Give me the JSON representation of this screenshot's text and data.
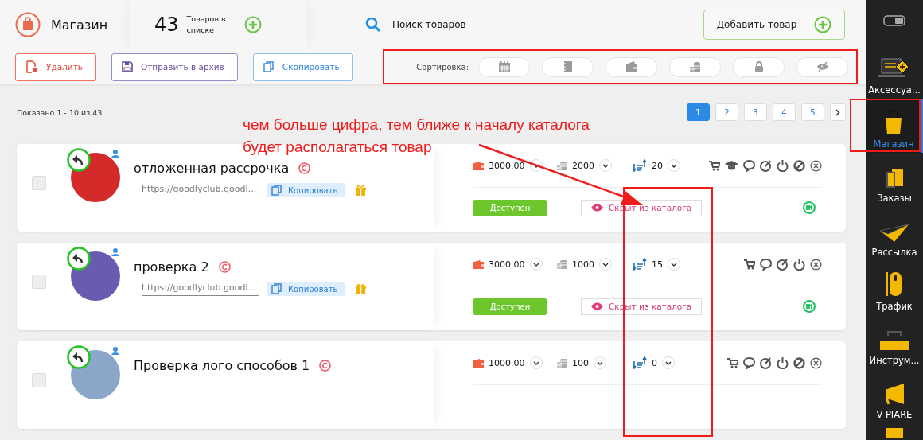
{
  "header": {
    "title": "Магазин",
    "count": "43",
    "count_label": "Товаров в списке",
    "search_label": "Поиск товаров",
    "add_button": "Добавить товар"
  },
  "actions": [
    {
      "kind": "delete",
      "label": "Удалить"
    },
    {
      "kind": "archive",
      "label": "Отправить в архив"
    },
    {
      "kind": "copy",
      "label": "Скопировать"
    }
  ],
  "sort": {
    "label": "Сортировка:"
  },
  "summary": "Показано 1 - 10 из 43",
  "pagination": [
    {
      "label": "1",
      "selected": true
    },
    {
      "label": "2",
      "selected": false
    },
    {
      "label": "3",
      "selected": false
    },
    {
      "label": "4",
      "selected": false
    },
    {
      "label": "5",
      "selected": false
    }
  ],
  "annotation": "чем больше цифра, тем ближе к началу каталога будет располагаться товар",
  "products": [
    {
      "checked": false,
      "title": "отложенная рассрочка",
      "url": "https://goodlyclub.goodl…",
      "copy_label": "Копировать",
      "price": "3000.00",
      "stock": "2000",
      "sort_value": "20",
      "status": "Доступен",
      "visibility": "Скрыт из каталога",
      "actions": [
        {
          "kind": "cart"
        },
        {
          "kind": "cap"
        },
        {
          "kind": "chat"
        },
        {
          "kind": "dial"
        },
        {
          "kind": "power"
        },
        {
          "kind": "ban"
        },
        {
          "kind": "close"
        }
      ]
    },
    {
      "checked": false,
      "title": "проверка 2",
      "url": "https://goodlyclub.goodl…",
      "copy_label": "Копировать",
      "price": "3000.00",
      "stock": "1000",
      "sort_value": "15",
      "status": "Доступен",
      "visibility": "Скрыт из каталога",
      "actions": [
        {
          "kind": "cart"
        },
        {
          "kind": "chat"
        },
        {
          "kind": "dial"
        },
        {
          "kind": "power"
        },
        {
          "kind": "close"
        }
      ]
    },
    {
      "checked": false,
      "title": "Проверка лого способов 1",
      "price": "1000.00",
      "stock": "100",
      "sort_value": "0",
      "actions": [
        {
          "kind": "cart"
        },
        {
          "kind": "chat"
        },
        {
          "kind": "dial"
        },
        {
          "kind": "power"
        },
        {
          "kind": "ban"
        },
        {
          "kind": "close"
        }
      ]
    }
  ],
  "sidebar": [
    {
      "kind": "toggle",
      "selected": false
    },
    {
      "kind": "accessories",
      "label": "Аксессуа...",
      "selected": false
    },
    {
      "kind": "shop",
      "label": "Магазин",
      "selected": true
    },
    {
      "kind": "orders",
      "label": "Заказы",
      "selected": false
    },
    {
      "kind": "mail",
      "label": "Рассылка",
      "selected": false
    },
    {
      "kind": "traffic",
      "label": "Трафик",
      "selected": false
    },
    {
      "kind": "tools",
      "label": "Инструм...",
      "selected": false
    },
    {
      "kind": "promo",
      "label": "V-PIARE",
      "selected": false
    },
    {
      "kind": "more",
      "selected": false
    }
  ]
}
